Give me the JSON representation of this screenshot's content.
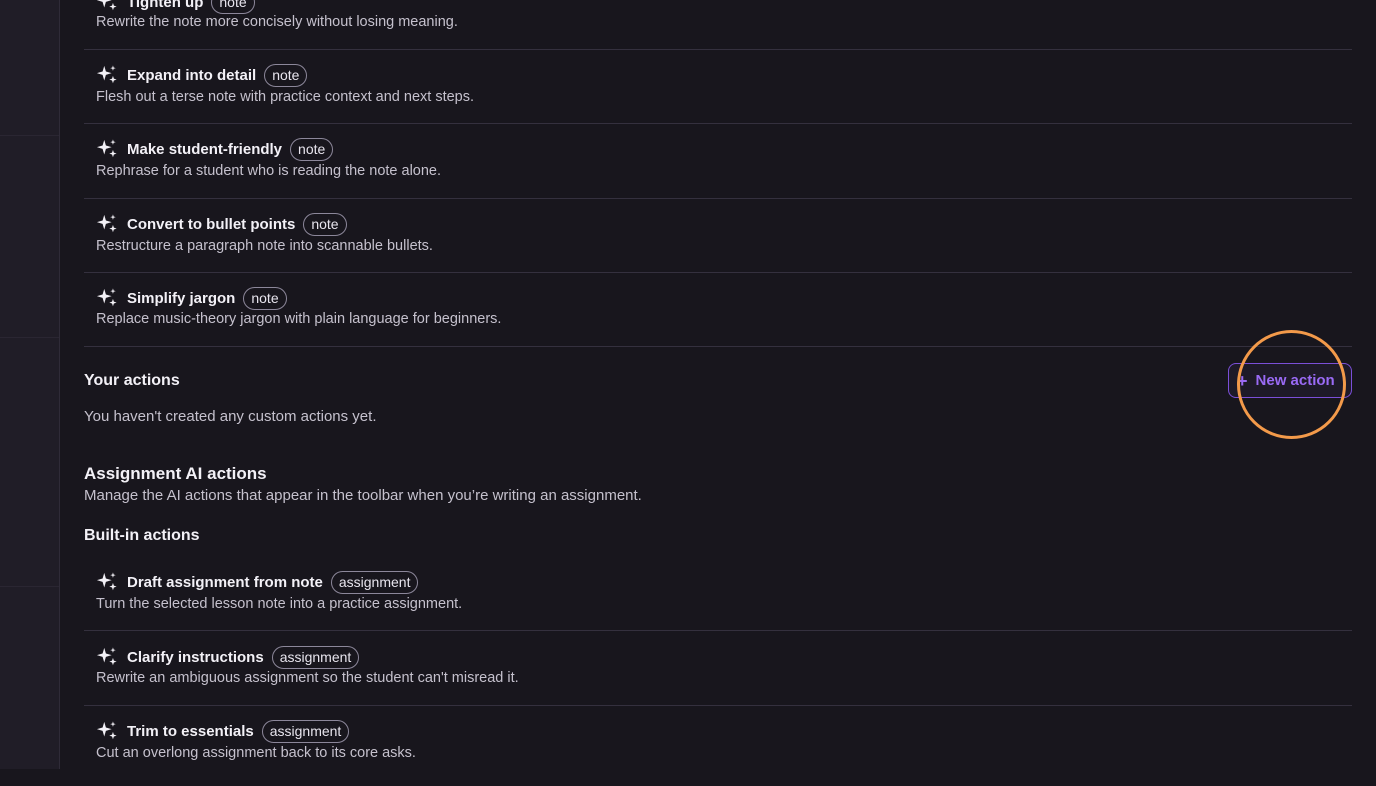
{
  "note_actions": [
    {
      "name": "Tighten up",
      "badge": "note",
      "description": "Rewrite the note more concisely without losing meaning."
    },
    {
      "name": "Expand into detail",
      "badge": "note",
      "description": "Flesh out a terse note with practice context and next steps."
    },
    {
      "name": "Make student-friendly",
      "badge": "note",
      "description": "Rephrase for a student who is reading the note alone."
    },
    {
      "name": "Convert to bullet points",
      "badge": "note",
      "description": "Restructure a paragraph note into scannable bullets."
    },
    {
      "name": "Simplify jargon",
      "badge": "note",
      "description": "Replace music-theory jargon with plain language for beginners."
    }
  ],
  "your_actions": {
    "heading": "Your actions",
    "empty_text": "You haven't created any custom actions yet.",
    "new_action_label": "New action"
  },
  "assignment_section": {
    "heading": "Assignment AI actions",
    "description": "Manage the AI actions that appear in the toolbar when you’re writing an assignment.",
    "builtin_heading": "Built-in actions"
  },
  "assignment_actions": [
    {
      "name": "Draft assignment from note",
      "badge": "assignment",
      "description": "Turn the selected lesson note into a practice assignment."
    },
    {
      "name": "Clarify instructions",
      "badge": "assignment",
      "description": "Rewrite an ambiguous assignment so the student can't misread it."
    },
    {
      "name": "Trim to essentials",
      "badge": "assignment",
      "description": "Cut an overlong assignment back to its core asks."
    }
  ],
  "icons": {
    "action_icon": "sparkles-icon",
    "add_icon": "plus-icon"
  },
  "colors": {
    "accent": "#9a6af5",
    "highlight_ring": "#f39a4a",
    "background": "#18161d"
  }
}
